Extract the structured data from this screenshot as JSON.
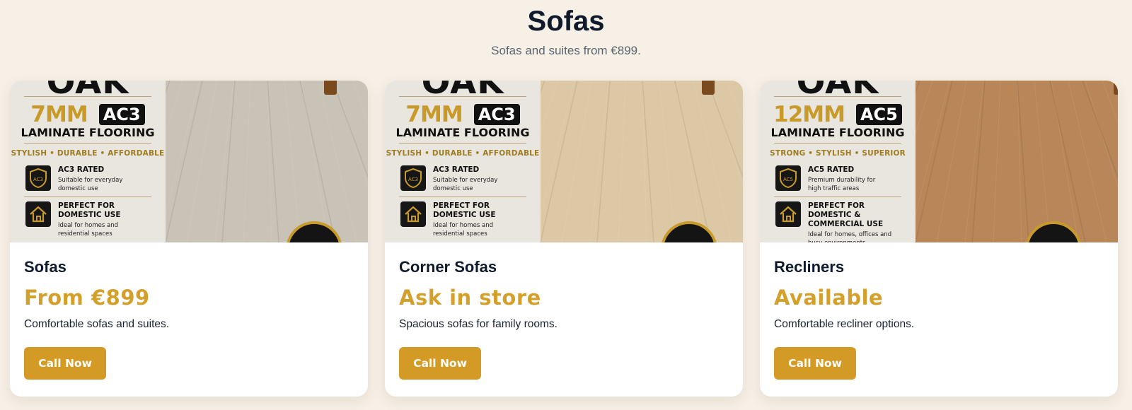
{
  "header": {
    "title": "Sofas",
    "subtitle": "Sofas and suites from €899."
  },
  "cards": [
    {
      "title": "Sofas",
      "price": "From €899",
      "description": "Comfortable sofas and suites.",
      "button_label": "Call Now",
      "image": {
        "brand": "OAK",
        "thickness": "7MM",
        "rating": "AC3",
        "product": "LAMINATE FLOORING",
        "tagline": "STYLISH • DURABLE • AFFORDABLE",
        "features": [
          {
            "icon": "shield-icon",
            "badge": "AC3",
            "title": "AC3 RATED",
            "desc": [
              "Suitable for everyday",
              "domestic use"
            ]
          },
          {
            "icon": "house-icon",
            "title": [
              "PERFECT FOR",
              "DOMESTIC USE"
            ],
            "desc": [
              "Ideal for homes and",
              "residential spaces"
            ]
          }
        ],
        "floor_color": "#c9c2b6"
      }
    },
    {
      "title": "Corner Sofas",
      "price": "Ask in store",
      "description": "Spacious sofas for family rooms.",
      "button_label": "Call Now",
      "image": {
        "brand": "OAK",
        "thickness": "7MM",
        "rating": "AC3",
        "product": "LAMINATE FLOORING",
        "tagline": "STYLISH • DURABLE • AFFORDABLE",
        "features": [
          {
            "icon": "shield-icon",
            "badge": "AC3",
            "title": "AC3 RATED",
            "desc": [
              "Suitable for everyday",
              "domestic use"
            ]
          },
          {
            "icon": "house-icon",
            "title": [
              "PERFECT FOR",
              "DOMESTIC USE"
            ],
            "desc": [
              "Ideal for homes and",
              "residential spaces"
            ]
          }
        ],
        "floor_color": "#dcc8a4"
      }
    },
    {
      "title": "Recliners",
      "price": "Available",
      "description": "Comfortable recliner options.",
      "button_label": "Call Now",
      "image": {
        "brand": "OAK",
        "thickness": "12MM",
        "rating": "AC5",
        "product": "LAMINATE FLOORING",
        "tagline": "STRONG • STYLISH • SUPERIOR",
        "features": [
          {
            "icon": "shield-icon",
            "badge": "AC5",
            "title": "AC5 RATED",
            "desc": [
              "Premium durability for",
              "high traffic areas"
            ]
          },
          {
            "icon": "house-icon",
            "title": [
              "PERFECT FOR",
              "DOMESTIC & COMMERCIAL USE"
            ],
            "desc": [
              "Ideal for homes, offices and",
              "busy environments"
            ]
          }
        ],
        "floor_color": "#b88658"
      }
    }
  ],
  "colors": {
    "background": "#f7f0e6",
    "accent": "#d49a26",
    "heading": "#0f1b2d"
  }
}
